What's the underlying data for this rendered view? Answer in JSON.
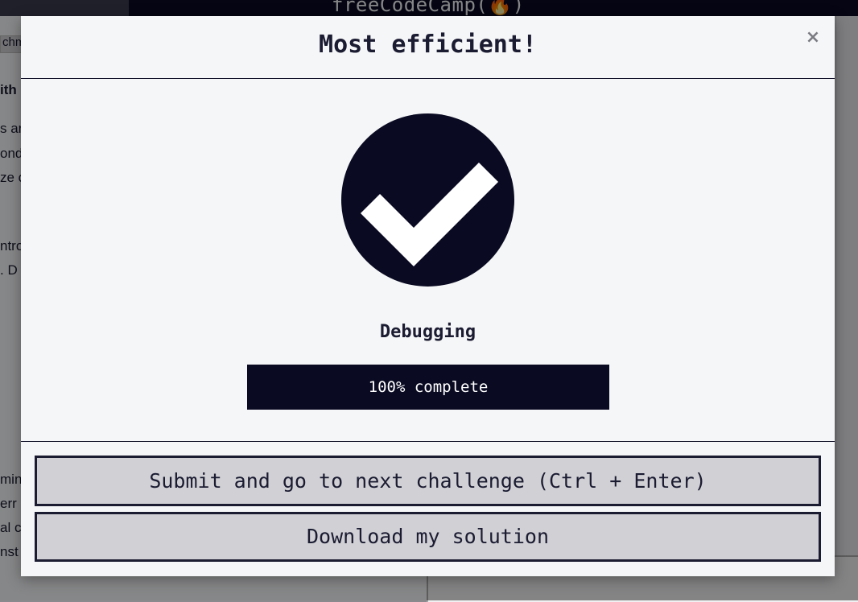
{
  "background": {
    "logo_text": "freeCodeCamp(🔥)",
    "tab_fragment": "chm",
    "text_fragments": [
      "ith",
      "s ar",
      "ond",
      "ze c",
      "ntro",
      ". D",
      "min",
      "err",
      "al c",
      "nst"
    ]
  },
  "modal": {
    "title": "Most efficient!",
    "close_label": "×",
    "check_icon": "checkmark-circle-icon",
    "challenge_name": "Debugging",
    "progress": {
      "percent": 100,
      "label": "100% complete"
    },
    "buttons": {
      "submit_label": "Submit and go to next challenge (Ctrl + Enter)",
      "download_label": "Download my solution"
    }
  },
  "colors": {
    "primary_dark": "#0a0a23",
    "text": "#1b1b32",
    "button_bg": "#d0d0d5",
    "modal_bg": "#f5f6f7"
  }
}
